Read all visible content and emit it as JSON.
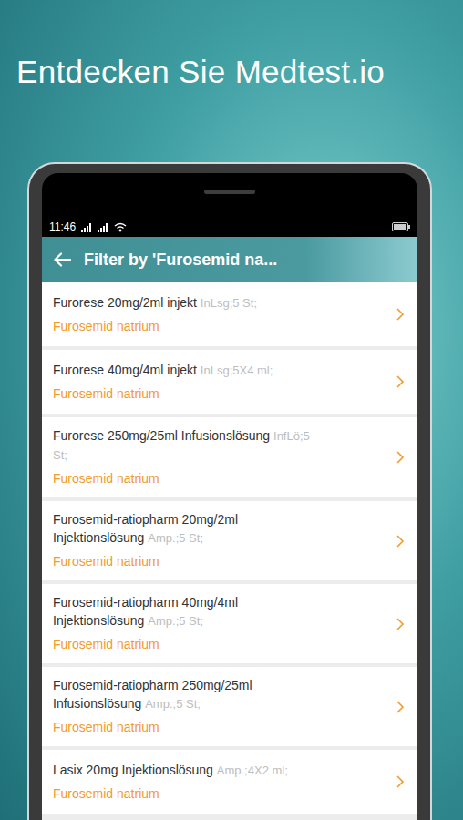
{
  "headline": "Entdecken Sie Medtest.io",
  "status_bar": {
    "time": "11:46"
  },
  "app_bar": {
    "title": "Filter by 'Furosemid na..."
  },
  "list": [
    {
      "name": "Furorese 20mg/2ml injekt",
      "package": "InLsg;5 St;",
      "substance": "Furosemid natrium"
    },
    {
      "name": "Furorese 40mg/4ml injekt",
      "package": "InLsg;5X4 ml;",
      "substance": "Furosemid natrium"
    },
    {
      "name": "Furorese 250mg/25ml Infusionslösung",
      "package": "InfLö;5 St;",
      "substance": "Furosemid natrium"
    },
    {
      "name": "Furosemid-ratiopharm 20mg/2ml Injektionslösung",
      "package": "Amp.;5 St;",
      "substance": "Furosemid natrium"
    },
    {
      "name": "Furosemid-ratiopharm 40mg/4ml Injektionslösung",
      "package": "Amp.;5 St;",
      "substance": "Furosemid natrium"
    },
    {
      "name": "Furosemid-ratiopharm 250mg/25ml Infusionslösung",
      "package": "Amp.;5 St;",
      "substance": "Furosemid natrium"
    },
    {
      "name": "Lasix 20mg Injektionslösung",
      "package": "Amp.;4X2 ml;",
      "substance": "Furosemid natrium"
    }
  ]
}
